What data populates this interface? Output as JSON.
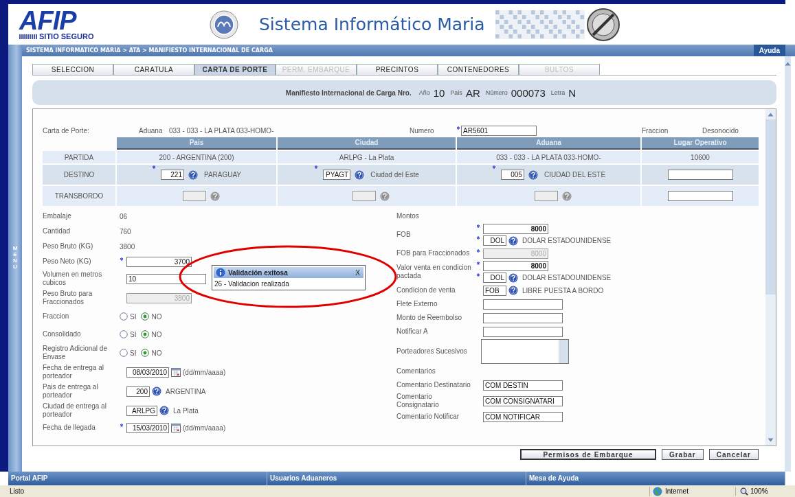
{
  "header": {
    "logo": "AFIP",
    "logo_caption": "SITIO SEGURO",
    "title": "Sistema Informático Maria"
  },
  "breadcrumb": "SISTEMA INFORMATICO MARIA > ATA > MANIFIESTO INTERNACIONAL DE CARGA",
  "help_button": "Ayuda",
  "menu_label": "MENU",
  "tabs": [
    {
      "label": "SELECCION",
      "selected": false,
      "disabled": false
    },
    {
      "label": "CARATULA",
      "selected": false,
      "disabled": false
    },
    {
      "label": "CARTA DE PORTE",
      "selected": true,
      "disabled": false
    },
    {
      "label": "PERM. EMBARQUE",
      "selected": false,
      "disabled": true
    },
    {
      "label": "PRECINTOS",
      "selected": false,
      "disabled": false
    },
    {
      "label": "CONTENEDORES",
      "selected": false,
      "disabled": false
    },
    {
      "label": "BULTOS",
      "selected": false,
      "disabled": true
    }
  ],
  "manifest": {
    "label": "Manifiesto Internacional de Carga Nro.",
    "fields": [
      {
        "label": "Año",
        "value": "10"
      },
      {
        "label": "Pais",
        "value": "AR"
      },
      {
        "label": "Número",
        "value": "000073"
      },
      {
        "label": "Letra",
        "value": "N"
      }
    ]
  },
  "carta": {
    "label": "Carta de Porte:",
    "aduana_label": "Aduana",
    "aduana_value": "033 - 033 - LA PLATA 033-HOMO-",
    "numero_label": "Numero",
    "numero_value": "AR5601",
    "numero_required": true,
    "fraccion_label": "Fraccion",
    "fraccion_value": "Desonocido"
  },
  "route_table": {
    "columns": [
      "Pais",
      "Ciudad",
      "Aduana",
      "Lugar Operativo"
    ],
    "rows": [
      {
        "label": "PARTIDA",
        "cells": [
          {
            "kind": "text",
            "text": "200 - ARGENTINA (200)"
          },
          {
            "kind": "text",
            "text": "ARLPG - La Plata"
          },
          {
            "kind": "text",
            "text": "033 - 033 - LA PLATA 033-HOMO-"
          },
          {
            "kind": "text",
            "text": "10600"
          }
        ]
      },
      {
        "label": "DESTINO",
        "cells": [
          {
            "kind": "lookup",
            "code": "221",
            "name": "PARAGUAY",
            "required": true,
            "disabled": false
          },
          {
            "kind": "lookup",
            "code": "PYAGT",
            "name": "Ciudad del Este",
            "required": true,
            "disabled": false
          },
          {
            "kind": "lookup",
            "code": "005",
            "name": "CIUDAD DEL ESTE",
            "required": true,
            "disabled": false
          },
          {
            "kind": "field"
          }
        ]
      },
      {
        "label": "TRANSBORDO",
        "cells": [
          {
            "kind": "lookup",
            "disabled": true
          },
          {
            "kind": "lookup",
            "disabled": true
          },
          {
            "kind": "lookup",
            "disabled": true
          },
          {
            "kind": "field"
          }
        ]
      }
    ]
  },
  "left_fields": [
    {
      "kind": "value",
      "label": "Embalaje",
      "value": "06"
    },
    {
      "kind": "value",
      "label": "Cantidad",
      "value": "760"
    },
    {
      "kind": "value",
      "label": "Peso Bruto (KG)",
      "value": "3800"
    },
    {
      "kind": "number",
      "label": "Peso Neto (KG)",
      "value": "3700",
      "required": true,
      "disabled": false
    },
    {
      "kind": "text",
      "label": "Volumen en metros cubicos",
      "value": "10",
      "disabled": false
    },
    {
      "kind": "number",
      "label": "Peso Bruto para Fraccionados",
      "value": "3800",
      "disabled": true
    },
    {
      "kind": "radio",
      "label": "Fraccion",
      "options": [
        {
          "label": "SI",
          "selected": false
        },
        {
          "label": "NO",
          "selected": true
        }
      ]
    },
    {
      "kind": "radio",
      "label": "Consolidado",
      "options": [
        {
          "label": "SI",
          "selected": false
        },
        {
          "label": "NO",
          "selected": true
        }
      ]
    },
    {
      "kind": "radio",
      "label": "Registro Adicional de Envase",
      "options": [
        {
          "label": "SI",
          "selected": false
        },
        {
          "label": "NO",
          "selected": true
        }
      ]
    },
    {
      "kind": "date",
      "label": "Fecha de entrega al porteador",
      "value": "08/03/2010",
      "hint": "(dd/mm/aaaa)"
    },
    {
      "kind": "lookup",
      "label": "Pais de entrega al porteador",
      "code": "200",
      "name": "ARGENTINA"
    },
    {
      "kind": "lookup",
      "label": "Ciudad de entrega al porteador",
      "code": "ARLPG",
      "name": "La Plata"
    },
    {
      "kind": "date",
      "label": "Fecha de llegada",
      "value": "15/03/2010",
      "hint": "(dd/mm/aaaa)",
      "required": true
    }
  ],
  "right_fields": [
    {
      "kind": "heading",
      "label": "Montos"
    },
    {
      "kind": "money",
      "label": "FOB",
      "amount": "8000",
      "currency_code": "DOL",
      "currency_name": "DOLAR ESTADOUNIDENSE",
      "required": true
    },
    {
      "kind": "number",
      "label": "FOB para Fraccionados",
      "value": "8000",
      "required": true,
      "disabled": true
    },
    {
      "kind": "money",
      "label": "Valor venta en condicion pactada",
      "amount": "8000",
      "currency_code": "DOL",
      "currency_name": "DOLAR ESTADOUNIDENSE",
      "required": true
    },
    {
      "kind": "lookup",
      "label": "Condicion de venta",
      "code": "FOB",
      "name": "LIBRE PUESTA A BORDO"
    },
    {
      "kind": "text",
      "label": "Flete Externo",
      "disabled": false
    },
    {
      "kind": "text",
      "label": "Monto de Reembolso",
      "disabled": false
    },
    {
      "kind": "text",
      "label": "Notificar A",
      "disabled": false
    },
    {
      "kind": "textarea",
      "label": "Porteadores Sucesivos"
    },
    {
      "kind": "heading",
      "label": "Comentarios"
    },
    {
      "kind": "text",
      "label": "Comentario Destinatario",
      "value": "COM DESTIN",
      "disabled": false
    },
    {
      "kind": "text",
      "label": "Comentario Consignatario",
      "value": "COM CONSIGNATARI",
      "disabled": false
    },
    {
      "kind": "text",
      "label": "Comentario Notificar",
      "value": "COM NOTIFICAR",
      "disabled": false
    }
  ],
  "popup": {
    "title": "Validación exitosa",
    "close": "X",
    "message": "26 - Validacion realizada"
  },
  "buttons": [
    "Permisos de Embarque",
    "Grabar",
    "Cancelar"
  ],
  "footer": [
    "Portal AFIP",
    "Usuarios Aduaneros",
    "Mesa de Ayuda"
  ],
  "status_bar": {
    "text": "Listo",
    "zone": "Internet",
    "zoom": "100%"
  }
}
